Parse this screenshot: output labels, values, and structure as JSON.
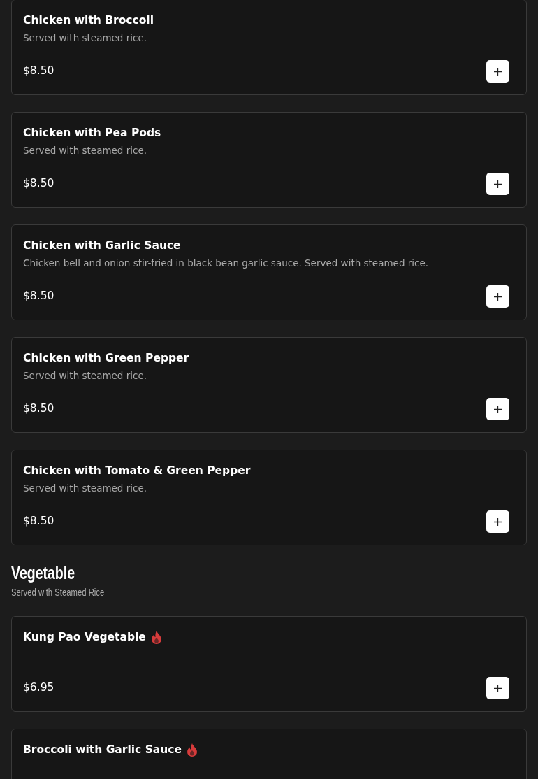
{
  "sections": [
    {
      "items": [
        {
          "name": "Chicken with Broccoli",
          "spicy": false,
          "description": "Served with steamed rice.",
          "price": "$8.50"
        },
        {
          "name": "Chicken with Pea Pods",
          "spicy": false,
          "description": "Served with steamed rice.",
          "price": "$8.50"
        },
        {
          "name": "Chicken with Garlic Sauce",
          "spicy": false,
          "description": "Chicken bell and onion stir-fried in black bean garlic sauce. Served with steamed rice.",
          "price": "$8.50"
        },
        {
          "name": "Chicken with Green Pepper",
          "spicy": false,
          "description": "Served with steamed rice.",
          "price": "$8.50"
        },
        {
          "name": "Chicken with Tomato & Green Pepper",
          "spicy": false,
          "description": "Served with steamed rice.",
          "price": "$8.50"
        }
      ]
    },
    {
      "title": "Vegetable",
      "subtitle": "Served with Steamed Rice",
      "items": [
        {
          "name": "Kung Pao Vegetable",
          "spicy": true,
          "price": "$6.95"
        },
        {
          "name": "Broccoli with Garlic Sauce",
          "spicy": true
        }
      ]
    }
  ]
}
